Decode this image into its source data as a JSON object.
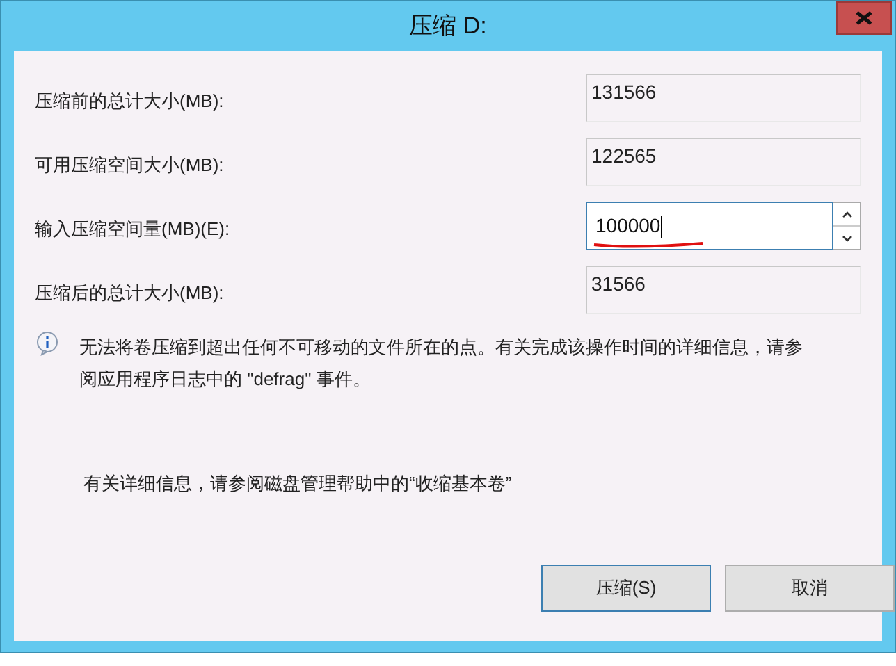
{
  "window": {
    "title": "压缩 D:"
  },
  "fields": [
    {
      "label": "压缩前的总计大小(MB):",
      "value": "131566",
      "kind": "readonly"
    },
    {
      "label": "可用压缩空间大小(MB):",
      "value": "122565",
      "kind": "readonly"
    },
    {
      "label": "输入压缩空间量(MB)(E):",
      "value": "100000",
      "kind": "spin"
    },
    {
      "label": "压缩后的总计大小(MB):",
      "value": "31566",
      "kind": "readonly"
    }
  ],
  "info": "无法将卷压缩到超出任何不可移动的文件所在的点。有关完成该操作时间的详细信息，请参阅应用程序日志中的 \"defrag\" 事件。",
  "help": "有关详细信息，请参阅磁盘管理帮助中的“收缩基本卷”",
  "buttons": [
    {
      "label": "压缩(S)",
      "default": true
    },
    {
      "label": "取消",
      "default": false
    }
  ]
}
